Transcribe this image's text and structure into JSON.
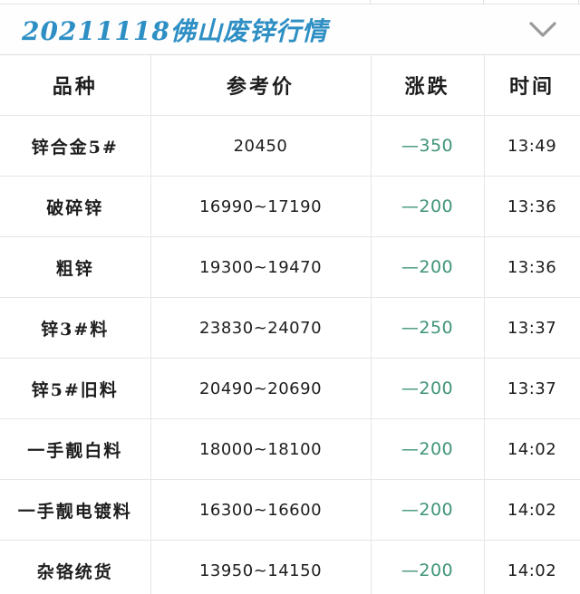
{
  "header": {
    "title": "20211118佛山废锌行情",
    "title_color": "#2e8fc4",
    "expand_icon": "chevron-down-icon"
  },
  "table": {
    "columns": [
      "品种",
      "参考价",
      "涨跌",
      "时间"
    ],
    "change_color": "#3f9478",
    "rows": [
      {
        "name": "锌合金5#",
        "price": "20450",
        "change": "—350",
        "time": "13:49"
      },
      {
        "name": "破碎锌",
        "price": "16990~17190",
        "change": "—200",
        "time": "13:36"
      },
      {
        "name": "粗锌",
        "price": "19300~19470",
        "change": "—200",
        "time": "13:36"
      },
      {
        "name": "锌3#料",
        "price": "23830~24070",
        "change": "—250",
        "time": "13:37"
      },
      {
        "name": "锌5#旧料",
        "price": "20490~20690",
        "change": "—200",
        "time": "13:37"
      },
      {
        "name": "一手靓白料",
        "price": "18000~18100",
        "change": "—200",
        "time": "14:02"
      },
      {
        "name": "一手靓电镀料",
        "price": "16300~16600",
        "change": "—200",
        "time": "14:02"
      },
      {
        "name": "杂铬统货",
        "price": "13950~14150",
        "change": "—200",
        "time": "14:02"
      }
    ]
  }
}
